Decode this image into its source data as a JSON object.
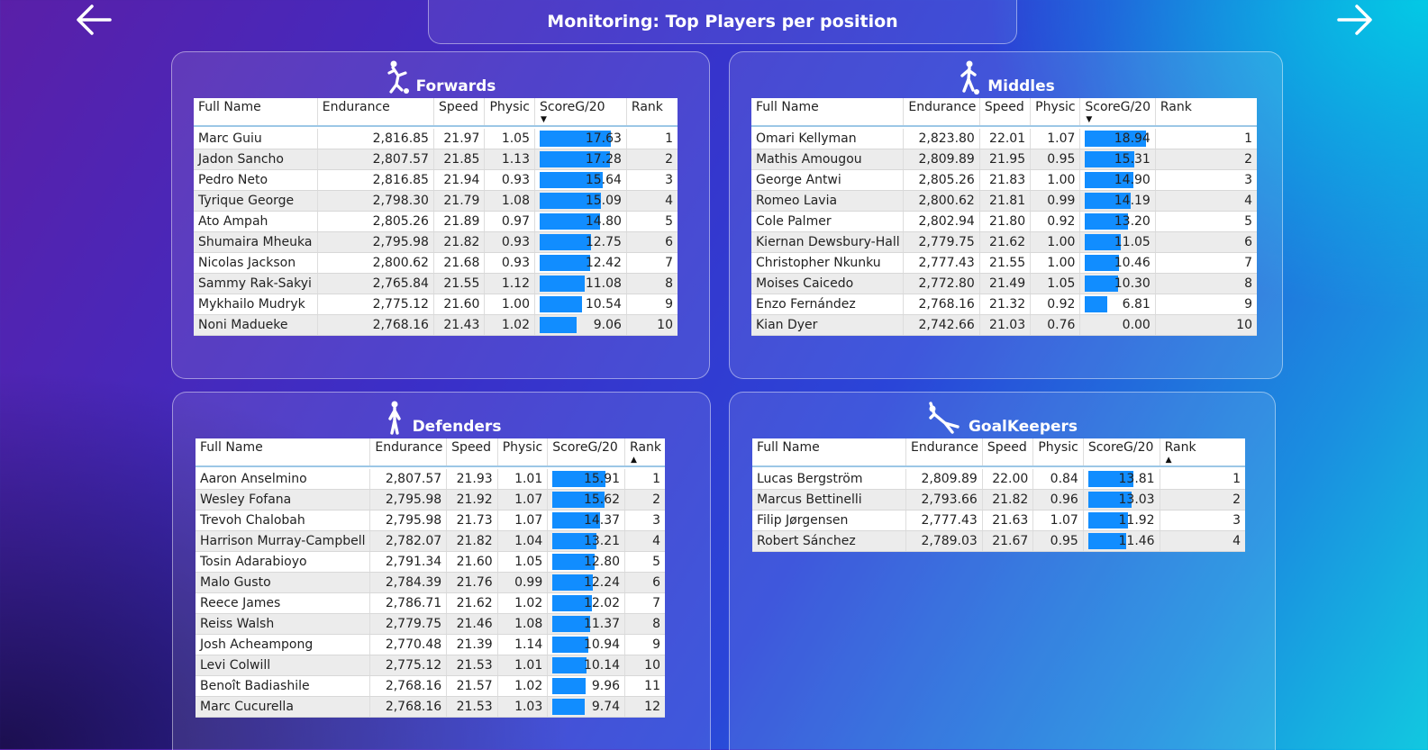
{
  "header": {
    "title": "Monitoring: Top Players per position"
  },
  "nav": {
    "back_icon": "arrow-left-icon",
    "forward_icon": "arrow-right-icon"
  },
  "colors": {
    "bar": "#118dff",
    "panel_border": "#ffffff"
  },
  "columns": [
    "Full Name",
    "Endurance",
    "Speed",
    "Physic",
    "ScoreG/20",
    "Rank"
  ],
  "score_max": 20,
  "panels": [
    {
      "id": "forwards",
      "title": "Forwards",
      "icon": "soccer-player-kicking-icon",
      "sort_column": "ScoreG/20",
      "sort_dir": "desc",
      "rows": [
        {
          "name": "Marc Guiu",
          "endurance": "2,816.85",
          "speed": "21.97",
          "physic": "1.05",
          "score": "17.63",
          "rank": "1"
        },
        {
          "name": "Jadon Sancho",
          "endurance": "2,807.57",
          "speed": "21.85",
          "physic": "1.13",
          "score": "17.28",
          "rank": "2"
        },
        {
          "name": "Pedro Neto",
          "endurance": "2,816.85",
          "speed": "21.94",
          "physic": "0.93",
          "score": "15.64",
          "rank": "3"
        },
        {
          "name": "Tyrique George",
          "endurance": "2,798.30",
          "speed": "21.79",
          "physic": "1.08",
          "score": "15.09",
          "rank": "4"
        },
        {
          "name": "Ato Ampah",
          "endurance": "2,805.26",
          "speed": "21.89",
          "physic": "0.97",
          "score": "14.80",
          "rank": "5"
        },
        {
          "name": "Shumaira Mheuka",
          "endurance": "2,795.98",
          "speed": "21.82",
          "physic": "0.93",
          "score": "12.75",
          "rank": "6"
        },
        {
          "name": "Nicolas Jackson",
          "endurance": "2,800.62",
          "speed": "21.68",
          "physic": "0.93",
          "score": "12.42",
          "rank": "7"
        },
        {
          "name": "Sammy Rak-Sakyi",
          "endurance": "2,765.84",
          "speed": "21.55",
          "physic": "1.12",
          "score": "11.08",
          "rank": "8"
        },
        {
          "name": "Mykhailo Mudryk",
          "endurance": "2,775.12",
          "speed": "21.60",
          "physic": "1.00",
          "score": "10.54",
          "rank": "9"
        },
        {
          "name": "Noni Madueke",
          "endurance": "2,768.16",
          "speed": "21.43",
          "physic": "1.02",
          "score": "9.06",
          "rank": "10"
        }
      ]
    },
    {
      "id": "middles",
      "title": "Middles",
      "icon": "soccer-player-dribbling-icon",
      "sort_column": "ScoreG/20",
      "sort_dir": "desc",
      "rows": [
        {
          "name": "Omari Kellyman",
          "endurance": "2,823.80",
          "speed": "22.01",
          "physic": "1.07",
          "score": "18.94",
          "rank": "1"
        },
        {
          "name": "Mathis Amougou",
          "endurance": "2,809.89",
          "speed": "21.95",
          "physic": "0.95",
          "score": "15.31",
          "rank": "2"
        },
        {
          "name": "George Antwi",
          "endurance": "2,805.26",
          "speed": "21.83",
          "physic": "1.00",
          "score": "14.90",
          "rank": "3"
        },
        {
          "name": "Romeo Lavia",
          "endurance": "2,800.62",
          "speed": "21.81",
          "physic": "0.99",
          "score": "14.19",
          "rank": "4"
        },
        {
          "name": "Cole Palmer",
          "endurance": "2,802.94",
          "speed": "21.80",
          "physic": "0.92",
          "score": "13.20",
          "rank": "5"
        },
        {
          "name": "Kiernan Dewsbury-Hall",
          "endurance": "2,779.75",
          "speed": "21.62",
          "physic": "1.00",
          "score": "11.05",
          "rank": "6"
        },
        {
          "name": "Christopher Nkunku",
          "endurance": "2,777.43",
          "speed": "21.55",
          "physic": "1.00",
          "score": "10.46",
          "rank": "7"
        },
        {
          "name": "Moises Caicedo",
          "endurance": "2,772.80",
          "speed": "21.49",
          "physic": "1.05",
          "score": "10.30",
          "rank": "8"
        },
        {
          "name": "Enzo Fernández",
          "endurance": "2,768.16",
          "speed": "21.32",
          "physic": "0.92",
          "score": "6.81",
          "rank": "9"
        },
        {
          "name": "Kian Dyer",
          "endurance": "2,742.66",
          "speed": "21.03",
          "physic": "0.76",
          "score": "0.00",
          "rank": "10"
        }
      ]
    },
    {
      "id": "defenders",
      "title": "Defenders",
      "icon": "soccer-player-standing-icon",
      "sort_column": "Rank",
      "sort_dir": "asc",
      "rows": [
        {
          "name": "Aaron Anselmino",
          "endurance": "2,807.57",
          "speed": "21.93",
          "physic": "1.01",
          "score": "15.91",
          "rank": "1"
        },
        {
          "name": "Wesley Fofana",
          "endurance": "2,795.98",
          "speed": "21.92",
          "physic": "1.07",
          "score": "15.62",
          "rank": "2"
        },
        {
          "name": "Trevoh Chalobah",
          "endurance": "2,795.98",
          "speed": "21.73",
          "physic": "1.07",
          "score": "14.37",
          "rank": "3"
        },
        {
          "name": "Harrison Murray-Campbell",
          "endurance": "2,782.07",
          "speed": "21.82",
          "physic": "1.04",
          "score": "13.21",
          "rank": "4"
        },
        {
          "name": "Tosin Adarabioyo",
          "endurance": "2,791.34",
          "speed": "21.60",
          "physic": "1.05",
          "score": "12.80",
          "rank": "5"
        },
        {
          "name": "Malo Gusto",
          "endurance": "2,784.39",
          "speed": "21.76",
          "physic": "0.99",
          "score": "12.24",
          "rank": "6"
        },
        {
          "name": "Reece James",
          "endurance": "2,786.71",
          "speed": "21.62",
          "physic": "1.02",
          "score": "12.02",
          "rank": "7"
        },
        {
          "name": "Reiss Walsh",
          "endurance": "2,779.75",
          "speed": "21.46",
          "physic": "1.08",
          "score": "11.37",
          "rank": "8"
        },
        {
          "name": "Josh Acheampong",
          "endurance": "2,770.48",
          "speed": "21.39",
          "physic": "1.14",
          "score": "10.94",
          "rank": "9"
        },
        {
          "name": "Levi Colwill",
          "endurance": "2,775.12",
          "speed": "21.53",
          "physic": "1.01",
          "score": "10.14",
          "rank": "10"
        },
        {
          "name": "Benoît Badiashile",
          "endurance": "2,768.16",
          "speed": "21.57",
          "physic": "1.02",
          "score": "9.96",
          "rank": "11"
        },
        {
          "name": "Marc Cucurella",
          "endurance": "2,768.16",
          "speed": "21.53",
          "physic": "1.03",
          "score": "9.74",
          "rank": "12"
        }
      ]
    },
    {
      "id": "goalkeepers",
      "title": "GoalKeepers",
      "icon": "goalkeeper-diving-icon",
      "sort_column": "Rank",
      "sort_dir": "asc",
      "rows": [
        {
          "name": "Lucas Bergström",
          "endurance": "2,809.89",
          "speed": "22.00",
          "physic": "0.84",
          "score": "13.81",
          "rank": "1"
        },
        {
          "name": "Marcus Bettinelli",
          "endurance": "2,793.66",
          "speed": "21.82",
          "physic": "0.96",
          "score": "13.03",
          "rank": "2"
        },
        {
          "name": "Filip Jørgensen",
          "endurance": "2,777.43",
          "speed": "21.63",
          "physic": "1.07",
          "score": "11.92",
          "rank": "3"
        },
        {
          "name": "Robert Sánchez",
          "endurance": "2,789.03",
          "speed": "21.67",
          "physic": "0.95",
          "score": "11.46",
          "rank": "4"
        }
      ]
    }
  ]
}
